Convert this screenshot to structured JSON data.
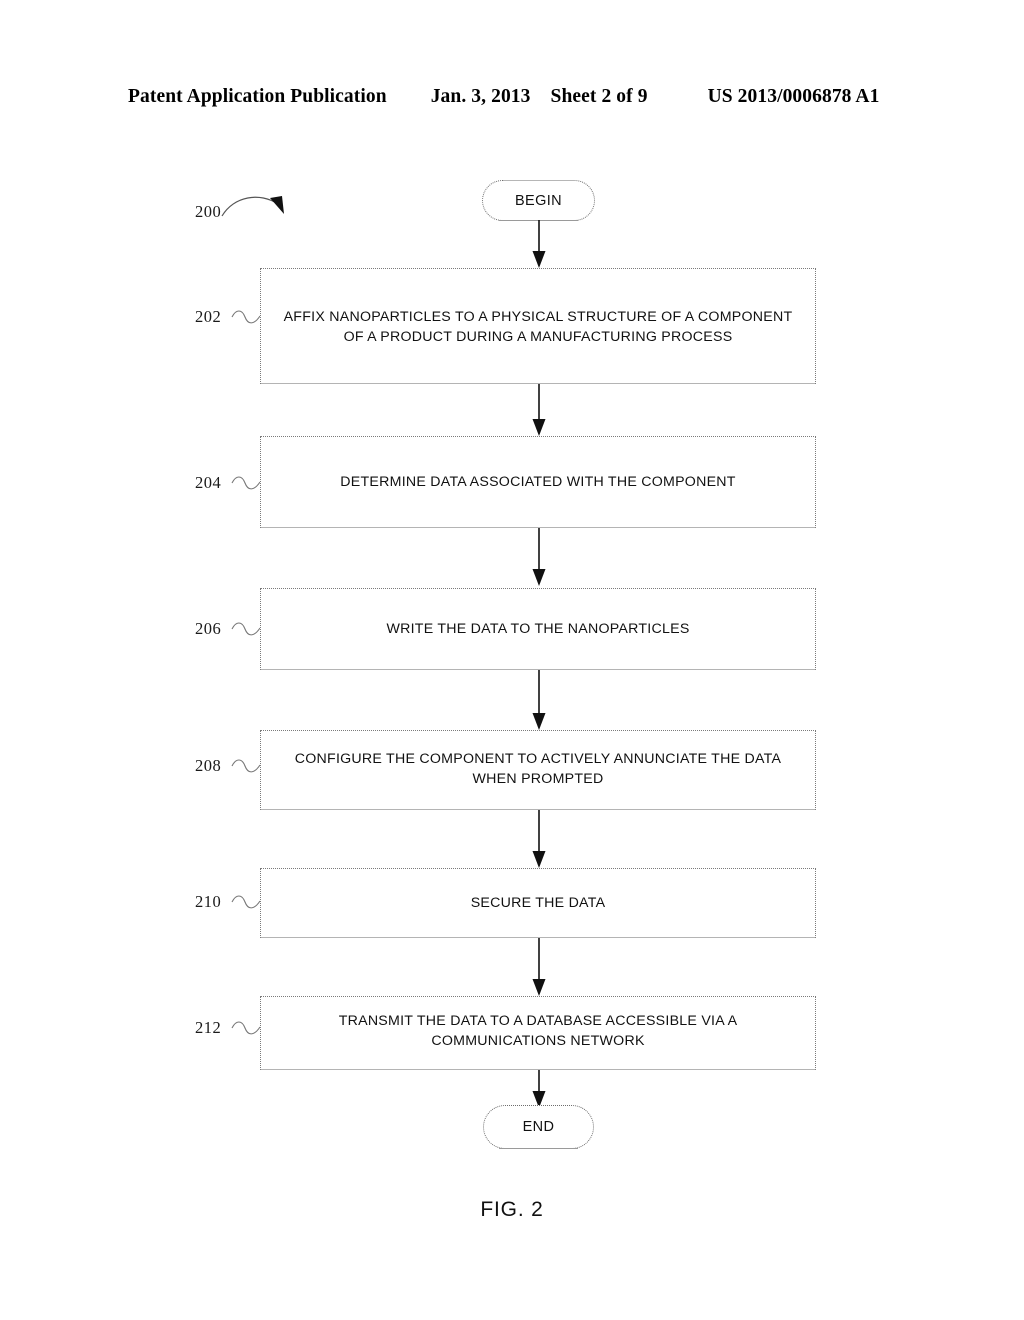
{
  "header": {
    "publication": "Patent Application Publication",
    "date": "Jan. 3, 2013",
    "sheet": "Sheet 2 of 9",
    "document_number": "US 2013/0006878 A1"
  },
  "figure": {
    "caption": "FIG. 2",
    "diagram_label": "200"
  },
  "flowchart": {
    "type": "flowchart",
    "orientation": "top-to-bottom",
    "begin_label": "BEGIN",
    "end_label": "END",
    "steps": [
      {
        "ref": "202",
        "text": "AFFIX NANOPARTICLES TO A PHYSICAL STRUCTURE OF A COMPONENT OF A PRODUCT DURING A MANUFACTURING PROCESS"
      },
      {
        "ref": "204",
        "text": "DETERMINE DATA ASSOCIATED WITH THE COMPONENT"
      },
      {
        "ref": "206",
        "text": "WRITE THE DATA TO THE NANOPARTICLES"
      },
      {
        "ref": "208",
        "text": "CONFIGURE THE COMPONENT TO ACTIVELY ANNUNCIATE THE DATA WHEN PROMPTED"
      },
      {
        "ref": "210",
        "text": "SECURE THE DATA"
      },
      {
        "ref": "212",
        "text": "TRANSMIT THE DATA TO A DATABASE ACCESSIBLE VIA A COMMUNICATIONS NETWORK"
      }
    ]
  }
}
